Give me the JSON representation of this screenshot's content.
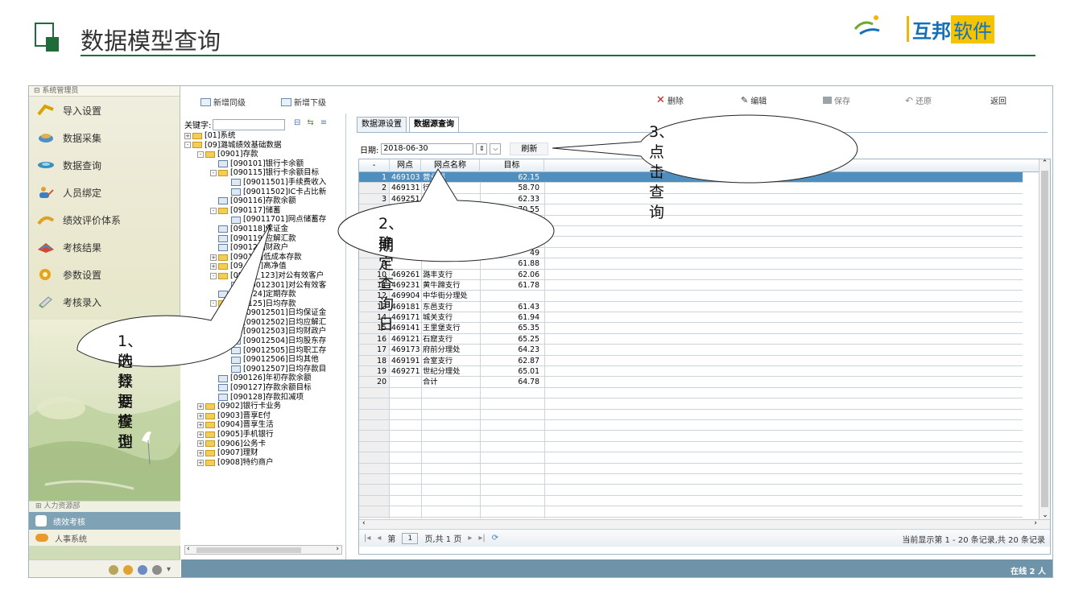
{
  "slide": {
    "title": "数据模型查询",
    "logo_main": "互邦",
    "logo_sub": "软件"
  },
  "colors": {
    "accent_green": "#1f6b3a",
    "status_bar": "#6f93a8",
    "selected_row": "#4f8fc0",
    "logo_blue": "#1570b8",
    "logo_yellow": "#f5c400"
  },
  "sidebar": {
    "header": "系统管理员",
    "items": [
      {
        "label": "导入设置",
        "icon": "import-icon"
      },
      {
        "label": "数据采集",
        "icon": "collect-icon"
      },
      {
        "label": "数据查询",
        "icon": "query-icon"
      },
      {
        "label": "人员绑定",
        "icon": "person-bind-icon"
      },
      {
        "label": "绩效评价体系",
        "icon": "evaluation-icon"
      },
      {
        "label": "考核结果",
        "icon": "result-icon"
      },
      {
        "label": "参数设置",
        "icon": "gear-icon"
      },
      {
        "label": "考核录入",
        "icon": "entry-icon"
      }
    ],
    "hr_dept": "人力资源部",
    "active_module": "绩效考核",
    "hr_system": "人事系统"
  },
  "toolbar": {
    "add_same": "新增同级",
    "add_sub": "新增下级",
    "delete": "删除",
    "edit": "编辑",
    "save": "保存",
    "restore": "还原",
    "back": "返回"
  },
  "tree_panel": {
    "keyword_label": "关键字:",
    "nodes": [
      {
        "label": "[01]系统",
        "depth": 0,
        "kind": "folder",
        "sign": "+"
      },
      {
        "label": "[09]潞城绩效基础数据",
        "depth": 0,
        "kind": "folder",
        "sign": "-"
      },
      {
        "label": "[0901]存款",
        "depth": 1,
        "kind": "folder",
        "sign": "-"
      },
      {
        "label": "[090101]银行卡余额",
        "depth": 2,
        "kind": "leaf",
        "sign": ""
      },
      {
        "label": "[090115]银行卡余额目标",
        "depth": 2,
        "kind": "folder",
        "sign": "-"
      },
      {
        "label": "[09011501]手续费收入",
        "depth": 3,
        "kind": "leaf",
        "sign": ""
      },
      {
        "label": "[09011502]IC卡占比新",
        "depth": 3,
        "kind": "leaf",
        "sign": ""
      },
      {
        "label": "[090116]存款余额",
        "depth": 2,
        "kind": "leaf",
        "sign": ""
      },
      {
        "label": "[090117]储蓄",
        "depth": 2,
        "kind": "folder",
        "sign": "-"
      },
      {
        "label": "[09011701]网点储蓄存",
        "depth": 3,
        "kind": "leaf",
        "sign": ""
      },
      {
        "label": "[090118]保证金",
        "depth": 2,
        "kind": "leaf",
        "sign": ""
      },
      {
        "label": "[090119]应解汇款",
        "depth": 2,
        "kind": "leaf",
        "sign": ""
      },
      {
        "label": "[090120]财政户",
        "depth": 2,
        "kind": "leaf",
        "sign": ""
      },
      {
        "label": "[0901__]低成本存款",
        "depth": 2,
        "kind": "folder",
        "sign": "+"
      },
      {
        "label": "[09__22]高净值",
        "depth": 2,
        "kind": "folder",
        "sign": "+"
      },
      {
        "label": "[0901__123]对公有效客户",
        "depth": 2,
        "kind": "folder",
        "sign": "-"
      },
      {
        "label": "[09012301]对公有效客",
        "depth": 3,
        "kind": "leaf",
        "sign": ""
      },
      {
        "label": "[090124]定期存款",
        "depth": 2,
        "kind": "leaf",
        "sign": ""
      },
      {
        "label": "[090125]日均存款",
        "depth": 2,
        "kind": "folder",
        "sign": "-"
      },
      {
        "label": "[09012501]日均保证金",
        "depth": 3,
        "kind": "leaf",
        "sign": ""
      },
      {
        "label": "[09012502]日均应解汇",
        "depth": 3,
        "kind": "leaf",
        "sign": ""
      },
      {
        "label": "[09012503]日均财政户",
        "depth": 3,
        "kind": "leaf",
        "sign": ""
      },
      {
        "label": "[09012504]日均股东存",
        "depth": 3,
        "kind": "leaf",
        "sign": ""
      },
      {
        "label": "[09012505]日均职工存",
        "depth": 3,
        "kind": "leaf",
        "sign": ""
      },
      {
        "label": "[09012506]日均其他",
        "depth": 3,
        "kind": "leaf",
        "sign": ""
      },
      {
        "label": "[09012507]日均存款目",
        "depth": 3,
        "kind": "leaf",
        "sign": ""
      },
      {
        "label": "[090126]年初存款余额",
        "depth": 2,
        "kind": "leaf",
        "sign": ""
      },
      {
        "label": "[090127]存款余额目标",
        "depth": 2,
        "kind": "leaf",
        "sign": ""
      },
      {
        "label": "[090128]存款扣减项",
        "depth": 2,
        "kind": "leaf",
        "sign": ""
      },
      {
        "label": "[0902]银行卡业务",
        "depth": 1,
        "kind": "folder",
        "sign": "+"
      },
      {
        "label": "[0903]晋享E付",
        "depth": 1,
        "kind": "folder",
        "sign": "+"
      },
      {
        "label": "[0904]晋享生活",
        "depth": 1,
        "kind": "folder",
        "sign": "+"
      },
      {
        "label": "[0905]手机银行",
        "depth": 1,
        "kind": "folder",
        "sign": "+"
      },
      {
        "label": "[0906]公务卡",
        "depth": 1,
        "kind": "folder",
        "sign": "+"
      },
      {
        "label": "[0907]理财",
        "depth": 1,
        "kind": "folder",
        "sign": "+"
      },
      {
        "label": "[0908]特约商户",
        "depth": 1,
        "kind": "folder",
        "sign": "+"
      }
    ]
  },
  "main": {
    "tabs": [
      "数据源设置",
      "数据源查询"
    ],
    "date_label": "日期:",
    "date_value": "2018-06-30",
    "refresh": "刷新",
    "columns": [
      "-",
      "网点",
      "网点名称",
      "目标"
    ],
    "rows": [
      {
        "n": "1",
        "wd": "469103",
        "name": "营业部",
        "target": "62.15"
      },
      {
        "n": "2",
        "wd": "469131",
        "name": "行",
        "target": "58.70"
      },
      {
        "n": "3",
        "wd": "469251",
        "name": "",
        "target": "62.33"
      },
      {
        "n": "4",
        "wd": "",
        "name": "",
        "target": "70.55"
      },
      {
        "n": "5",
        "wd": "",
        "name": "",
        "target": ""
      },
      {
        "n": "6",
        "wd": "",
        "name": "",
        "target": ""
      },
      {
        "n": "7",
        "wd": "",
        "name": "",
        "target": ""
      },
      {
        "n": "8",
        "wd": "",
        "name": "",
        "target": "49"
      },
      {
        "n": "9",
        "wd": "",
        "name": "",
        "target": "61.88"
      },
      {
        "n": "10",
        "wd": "469261",
        "name": "潞丰支行",
        "target": "62.06"
      },
      {
        "n": "11",
        "wd": "469231",
        "name": "黄牛蹄支行",
        "target": "61.78"
      },
      {
        "n": "12",
        "wd": "469904",
        "name": "中华街分理处",
        "target": ""
      },
      {
        "n": "13",
        "wd": "469181",
        "name": "东邑支行",
        "target": "61.43"
      },
      {
        "n": "14",
        "wd": "469171",
        "name": "城关支行",
        "target": "61.94"
      },
      {
        "n": "15",
        "wd": "469141",
        "name": "王里堡支行",
        "target": "65.35"
      },
      {
        "n": "16",
        "wd": "469121",
        "name": "石窟支行",
        "target": "65.25"
      },
      {
        "n": "17",
        "wd": "469173",
        "name": "府前分理处",
        "target": "64.23"
      },
      {
        "n": "18",
        "wd": "469191",
        "name": "合室支行",
        "target": "62.87"
      },
      {
        "n": "19",
        "wd": "469271",
        "name": "世纪分理处",
        "target": "65.01"
      },
      {
        "n": "20",
        "wd": "",
        "name": "合计",
        "target": "64.78"
      }
    ],
    "pager": {
      "prefix": "第",
      "page": "1",
      "suffix": "页,共 1 页",
      "info": "当前显示第 1 - 20 条记录,共 20 条记录"
    }
  },
  "status": {
    "online": "在线 2 人"
  },
  "callouts": {
    "c1": "1、选择要查询的数据模型",
    "c1_line1": "1、选择要查询",
    "c1_line2": "的数据模型",
    "c2_line1": "2、确定查询日",
    "c2_line2": "期",
    "c3": "3、点击查询"
  }
}
